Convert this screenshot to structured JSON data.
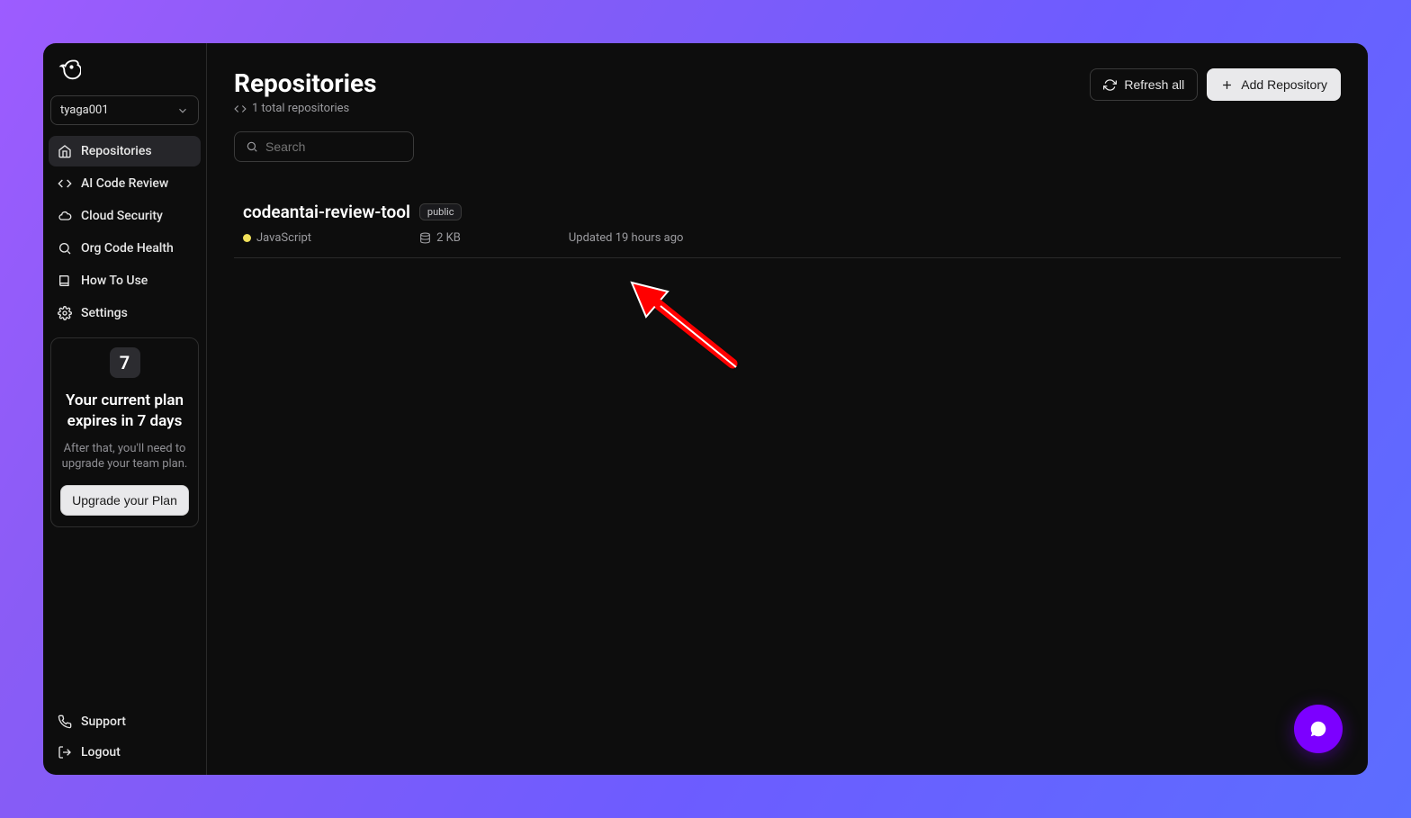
{
  "user": {
    "name": "tyaga001"
  },
  "sidebar": {
    "items": [
      {
        "label": "Repositories",
        "icon": "home-icon",
        "active": true
      },
      {
        "label": "AI Code Review",
        "icon": "code-icon",
        "active": false
      },
      {
        "label": "Cloud Security",
        "icon": "cloud-icon",
        "active": false
      },
      {
        "label": "Org Code Health",
        "icon": "search-icon",
        "active": false
      },
      {
        "label": "How To Use",
        "icon": "book-icon",
        "active": false
      },
      {
        "label": "Settings",
        "icon": "gear-icon",
        "active": false
      }
    ]
  },
  "plan_card": {
    "days": "7",
    "title": "Your current plan expires in 7 days",
    "sub": "After that, you'll need to upgrade your team plan.",
    "upgrade_label": "Upgrade your Plan"
  },
  "bottom": {
    "support": "Support",
    "logout": "Logout"
  },
  "page": {
    "title": "Repositories",
    "subtitle": "1 total repositories",
    "refresh_label": "Refresh all",
    "add_label": "Add Repository",
    "search_placeholder": "Search"
  },
  "repos": [
    {
      "name": "codeantai-review-tool",
      "visibility": "public",
      "language": "JavaScript",
      "language_color": "#f1e05a",
      "size": "2 KB",
      "updated": "Updated 19 hours ago"
    }
  ]
}
